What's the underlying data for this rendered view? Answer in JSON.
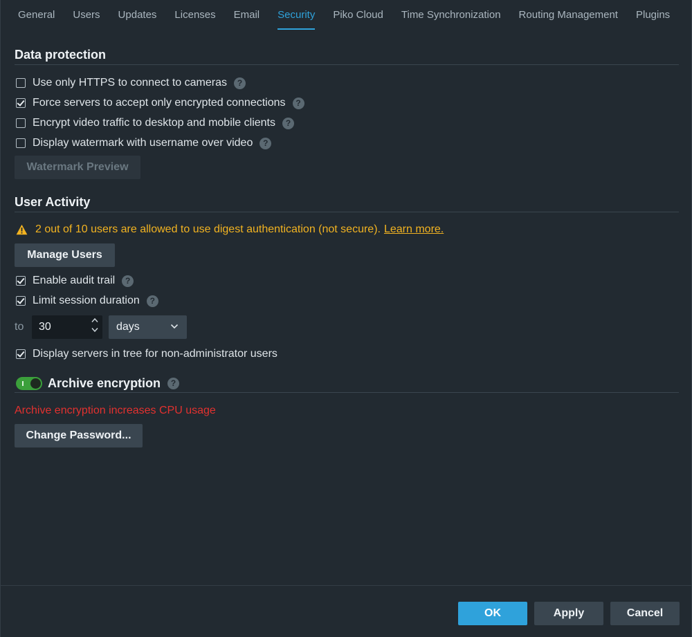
{
  "tabs": [
    {
      "label": "General"
    },
    {
      "label": "Users"
    },
    {
      "label": "Updates"
    },
    {
      "label": "Licenses"
    },
    {
      "label": "Email"
    },
    {
      "label": "Security",
      "active": true
    },
    {
      "label": "Piko Cloud"
    },
    {
      "label": "Time Synchronization"
    },
    {
      "label": "Routing Management"
    },
    {
      "label": "Plugins"
    }
  ],
  "data_protection": {
    "title": "Data protection",
    "options": [
      {
        "label": "Use only HTTPS to connect to cameras",
        "checked": false
      },
      {
        "label": "Force servers to accept only encrypted connections",
        "checked": true
      },
      {
        "label": "Encrypt video traffic to desktop and mobile clients",
        "checked": false
      },
      {
        "label": "Display watermark with username over video",
        "checked": false
      }
    ],
    "watermark_button": "Watermark Preview"
  },
  "user_activity": {
    "title": "User Activity",
    "warning_text": "2 out of 10 users are allowed to use digest authentication (not secure).",
    "warning_link": "Learn more.",
    "manage_users_button": "Manage Users",
    "audit_trail": {
      "label": "Enable audit trail",
      "checked": true
    },
    "limit_session": {
      "label": "Limit session duration",
      "checked": true
    },
    "to_label": "to",
    "duration_value": "30",
    "duration_unit": "days",
    "display_servers": {
      "label": "Display servers in tree for non-administrator users",
      "checked": true
    }
  },
  "archive_encryption": {
    "label": "Archive encryption",
    "enabled": true,
    "warning": "Archive encryption increases CPU usage",
    "change_password_button": "Change Password..."
  },
  "footer": {
    "ok": "OK",
    "apply": "Apply",
    "cancel": "Cancel"
  },
  "colors": {
    "accent": "#2fa2db",
    "warning": "#f2b321",
    "error": "#e2312f",
    "toggle_on": "#3ba03b"
  },
  "icons": {
    "help": "question-icon",
    "warning": "warning-triangle-icon",
    "spin": "chevron-up-down-icon",
    "dropdown": "chevron-down-icon"
  },
  "help_glyph": "?"
}
